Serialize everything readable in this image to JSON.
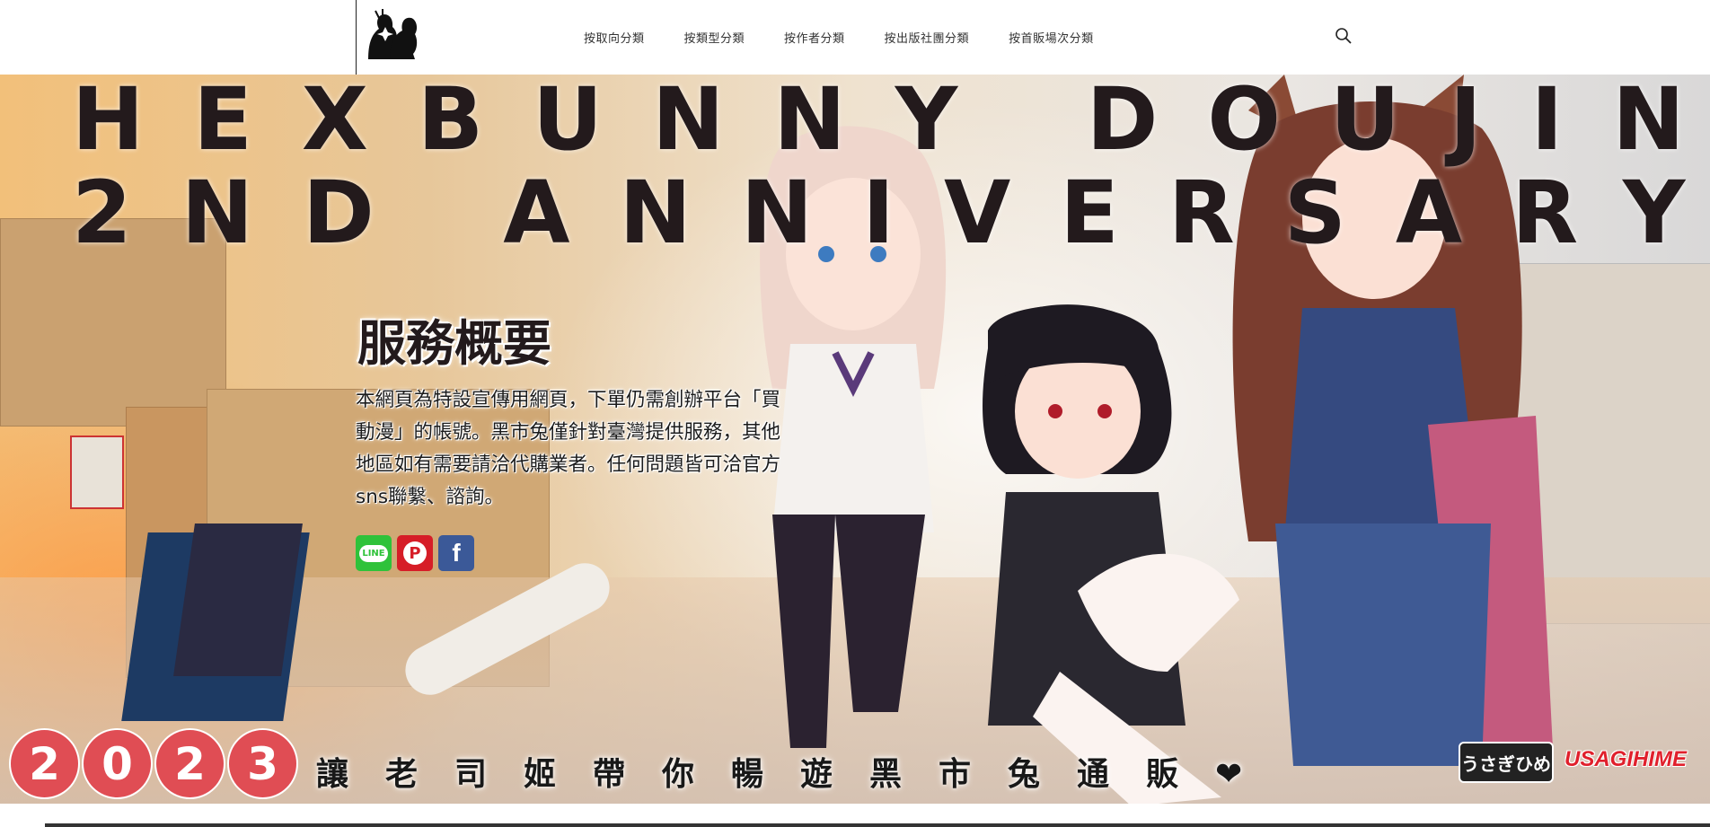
{
  "header": {
    "logo_icon": "hexbunny-silhouette-logo",
    "nav": [
      {
        "label": "按取向分類"
      },
      {
        "label": "按類型分類"
      },
      {
        "label": "按作者分類"
      },
      {
        "label": "按出版社團分類"
      },
      {
        "label": "按首販場次分類"
      }
    ],
    "search_icon": "search-icon"
  },
  "hero": {
    "title_line1": "HEXBUNNY DOUJIN",
    "title_line2": "2ND ANNIVERSARY",
    "service_title": "服務概要",
    "service_text": "本網頁為特設宣傳用網頁，下單仍需創辦平台「買動漫」的帳號。黑市兔僅針對臺灣提供服務，其他地區如有需要請洽代購業者。任何問題皆可洽官方sns聯繫、諮詢。",
    "social": [
      {
        "name": "line",
        "label": "LINE"
      },
      {
        "name": "pixiv",
        "label": "P"
      },
      {
        "name": "facebook",
        "label": "f"
      }
    ],
    "year_digits": [
      "2",
      "0",
      "2",
      "3"
    ],
    "slogan": "讓老司姬帶你暢遊黑市兔通販❤",
    "brand_jp": "うさぎひめ",
    "brand_en": "USAGIHIME",
    "colors": {
      "accent_red": "#e04d54",
      "title_dark": "#231a1c"
    }
  }
}
